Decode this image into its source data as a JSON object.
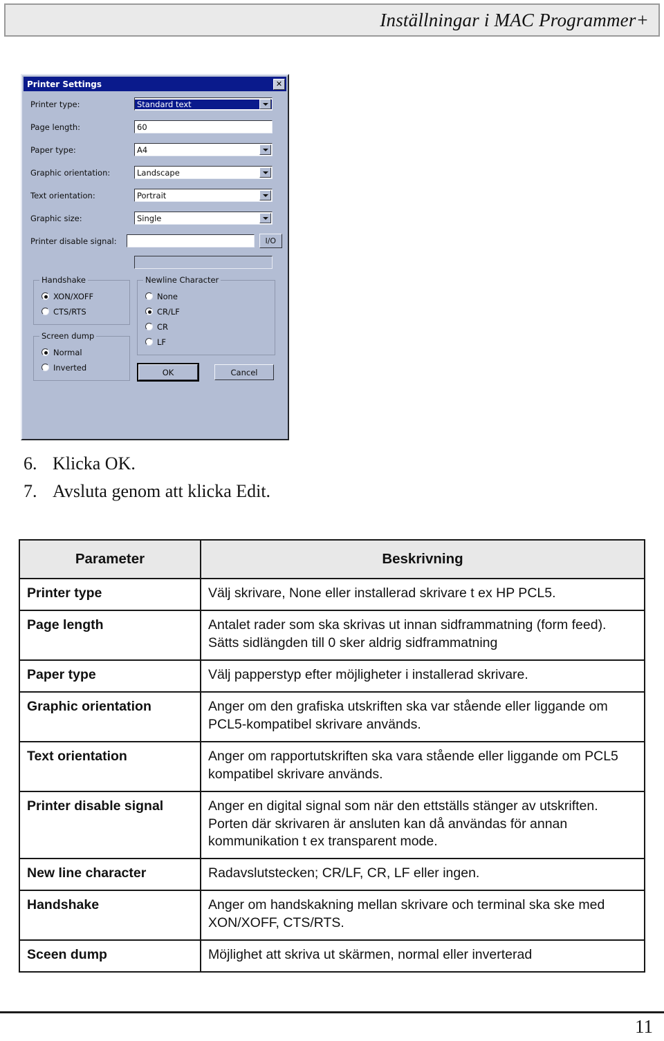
{
  "header": {
    "title": "Inställningar i MAC Programmer+"
  },
  "dialog": {
    "title": "Printer Settings",
    "close_icon": "close-icon",
    "fields": [
      {
        "label": "Printer type:",
        "value": "Standard text",
        "type": "combobox",
        "selected": true
      },
      {
        "label": "Page length:",
        "value": "60",
        "type": "textbox",
        "selected": false
      },
      {
        "label": "Paper type:",
        "value": "A4",
        "type": "combobox",
        "selected": false
      },
      {
        "label": "Graphic orientation:",
        "value": "Landscape",
        "type": "combobox",
        "selected": false
      },
      {
        "label": "Text orientation:",
        "value": "Portrait",
        "type": "combobox",
        "selected": false
      },
      {
        "label": "Graphic size:",
        "value": "Single",
        "type": "combobox",
        "selected": false
      },
      {
        "label": "Printer disable signal:",
        "value": "",
        "type": "textbox",
        "selected": false
      }
    ],
    "io_button_label": "I/O",
    "groups": {
      "handshake": {
        "legend": "Handshake",
        "options": [
          {
            "label": "XON/XOFF",
            "checked": true
          },
          {
            "label": "CTS/RTS",
            "checked": false
          }
        ]
      },
      "screen_dump": {
        "legend": "Screen dump",
        "options": [
          {
            "label": "Normal",
            "checked": true
          },
          {
            "label": "Inverted",
            "checked": false
          }
        ]
      },
      "newline_character": {
        "legend": "Newline Character",
        "options": [
          {
            "label": "None",
            "checked": false
          },
          {
            "label": "CR/LF",
            "checked": true
          },
          {
            "label": "CR",
            "checked": false
          },
          {
            "label": "LF",
            "checked": false
          }
        ]
      }
    },
    "buttons": {
      "ok": "OK",
      "cancel": "Cancel"
    }
  },
  "steps": [
    {
      "num": "6.",
      "text": "Klicka OK."
    },
    {
      "num": "7.",
      "text": "Avsluta genom att klicka Edit."
    }
  ],
  "table": {
    "headers": [
      "Parameter",
      "Beskrivning"
    ],
    "rows": [
      {
        "parameter": "Printer type",
        "description": "Välj skrivare, None eller installerad skrivare t ex HP PCL5."
      },
      {
        "parameter": "Page length",
        "description": "Antalet rader som ska skrivas ut innan sidframmatning (form feed). Sätts sidlängden till 0 sker aldrig sidframmatning"
      },
      {
        "parameter": "Paper type",
        "description": "Välj papperstyp efter möjligheter i installerad skrivare."
      },
      {
        "parameter": "Graphic orientation",
        "description": "Anger om den grafiska utskriften ska var stående eller liggande om PCL5-kompatibel skrivare används."
      },
      {
        "parameter": "Text orientation",
        "description": "Anger om rapportutskriften ska vara stående eller liggande om PCL5 kompatibel skrivare används."
      },
      {
        "parameter": "Printer disable signal",
        "description": "Anger en digital signal som när den ettställs stänger av utskriften. Porten där skrivaren är ansluten kan då användas för annan kommunikation t ex transparent mode."
      },
      {
        "parameter": "New line character",
        "description": "Radavslutstecken; CR/LF, CR, LF eller ingen."
      },
      {
        "parameter": "Handshake",
        "description": "Anger om handskakning mellan skrivare och terminal ska ske med XON/XOFF, CTS/RTS."
      },
      {
        "parameter": "Sceen dump",
        "description": "Möjlighet att skriva ut skärmen, normal eller inverterad"
      }
    ]
  },
  "footer": {
    "page_number": "11"
  },
  "colors": {
    "header_band": "#eaeaea",
    "dialog_face": "#b3bdd4",
    "titlebar": "#0a1a8c",
    "table_header": "#e8e8e8",
    "rule": "#1b1b1b"
  }
}
